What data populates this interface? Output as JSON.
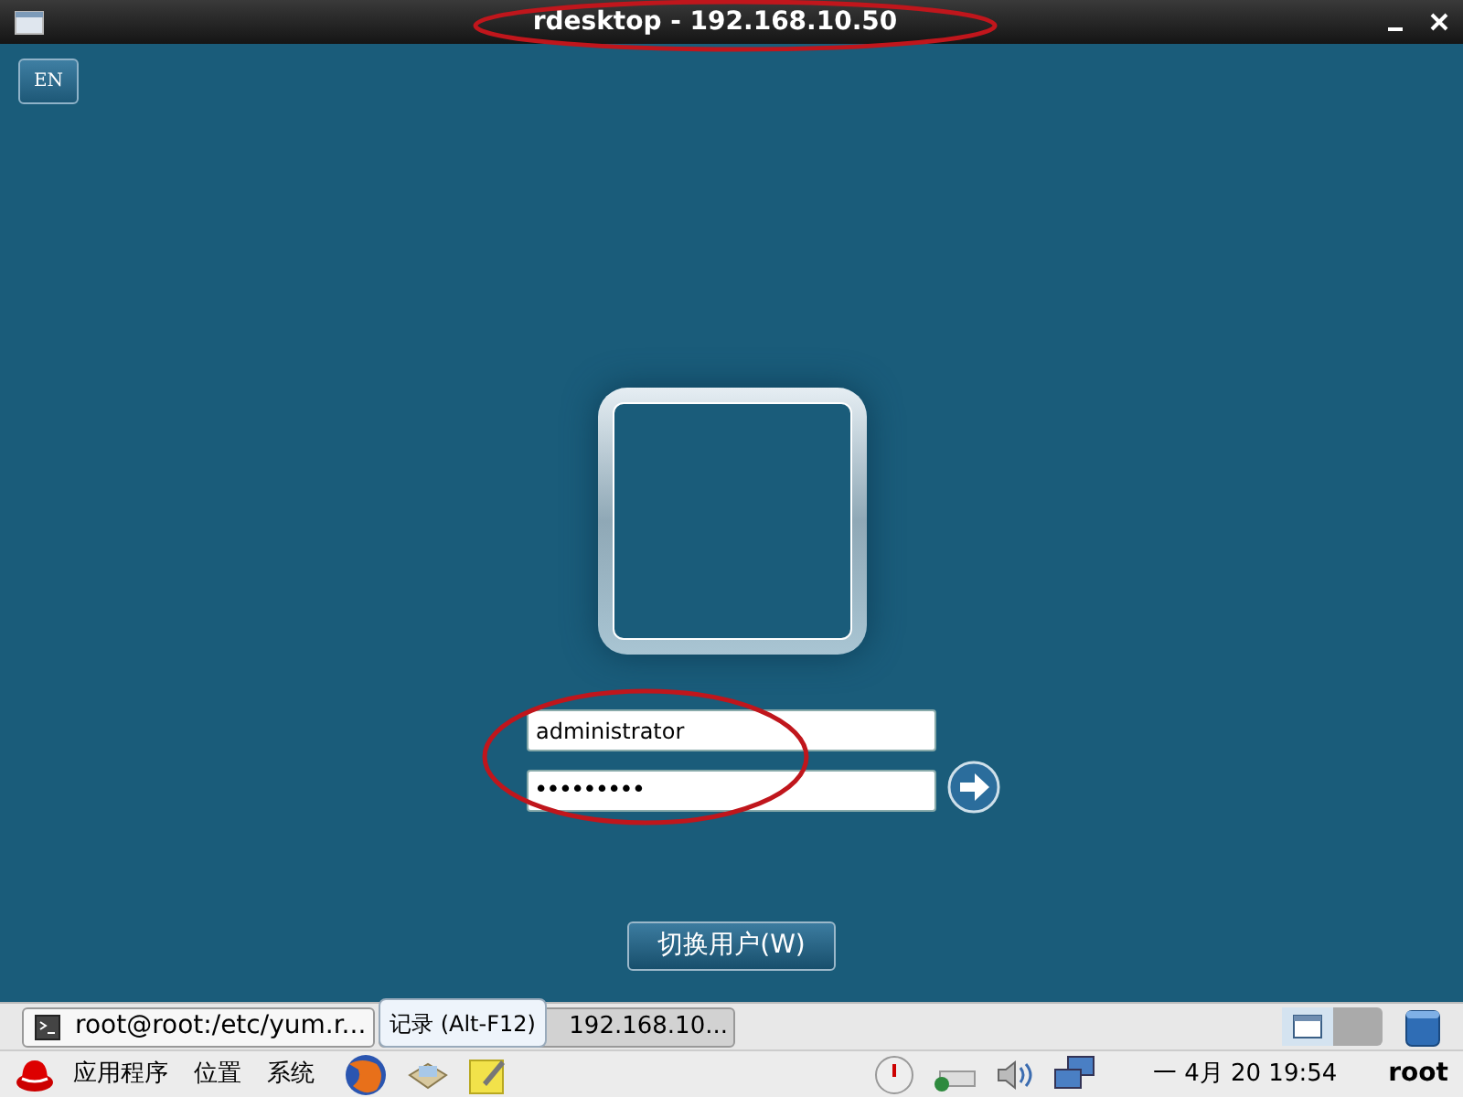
{
  "window": {
    "title": "rdesktop - 192.168.10.50",
    "circled": true
  },
  "keyboard_layout": "EN",
  "login": {
    "username": "administrator",
    "password": "•••••••••",
    "circled": true
  },
  "switch_user": "切换用户(W)",
  "taskbar": {
    "tasks": [
      {
        "label": "root@root:/etc/yum.r...",
        "selected": false
      },
      {
        "label": "192.168.10...",
        "selected": true
      }
    ],
    "tooltip": "记录 (Alt-F12)"
  },
  "panel": {
    "menus": [
      "应用程序",
      "位置",
      "系统"
    ],
    "clock": "一 4月 20 19:54",
    "user": "root"
  }
}
